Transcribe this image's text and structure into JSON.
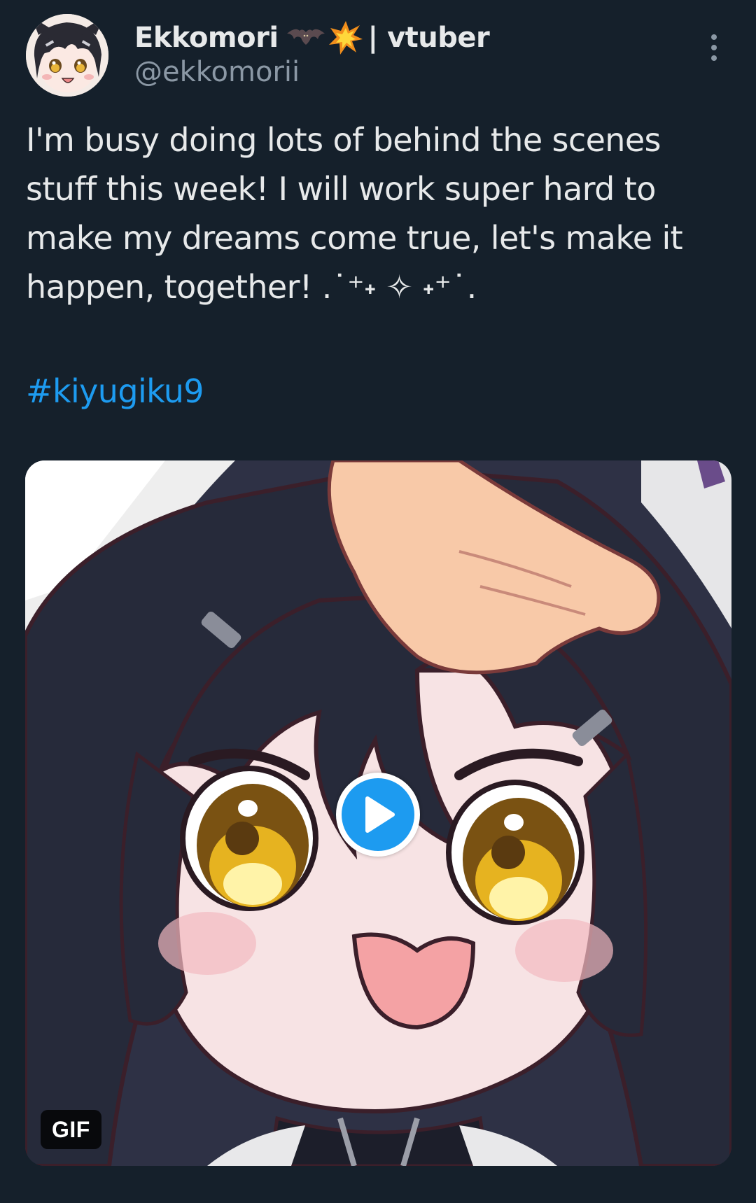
{
  "author": {
    "display_name": "Ekkomori",
    "name_emojis": [
      "bat-emoji",
      "collision-emoji"
    ],
    "name_suffix": "| vtuber",
    "handle": "@ekkomorii",
    "avatar_icon": "chibi-vtuber-avatar"
  },
  "tweet": {
    "text_lines": [
      "I'm busy doing lots of behind the scenes",
      "stuff this week! I will work super hard to",
      "make my dreams come true, let's make it",
      "happen, together! .˙⁺˖ ✧ ˖⁺˙."
    ],
    "hashtag": "#kiyugiku9"
  },
  "media": {
    "type": "gif",
    "badge_label": "GIF",
    "play_icon": "play-icon",
    "description_icon": "chibi-character-headpat-art"
  },
  "colors": {
    "background": "#15202b",
    "text": "#e7e9ea",
    "secondary_text": "#8b98a5",
    "link": "#1d9bf0",
    "play_button": "#1d9bf0"
  }
}
